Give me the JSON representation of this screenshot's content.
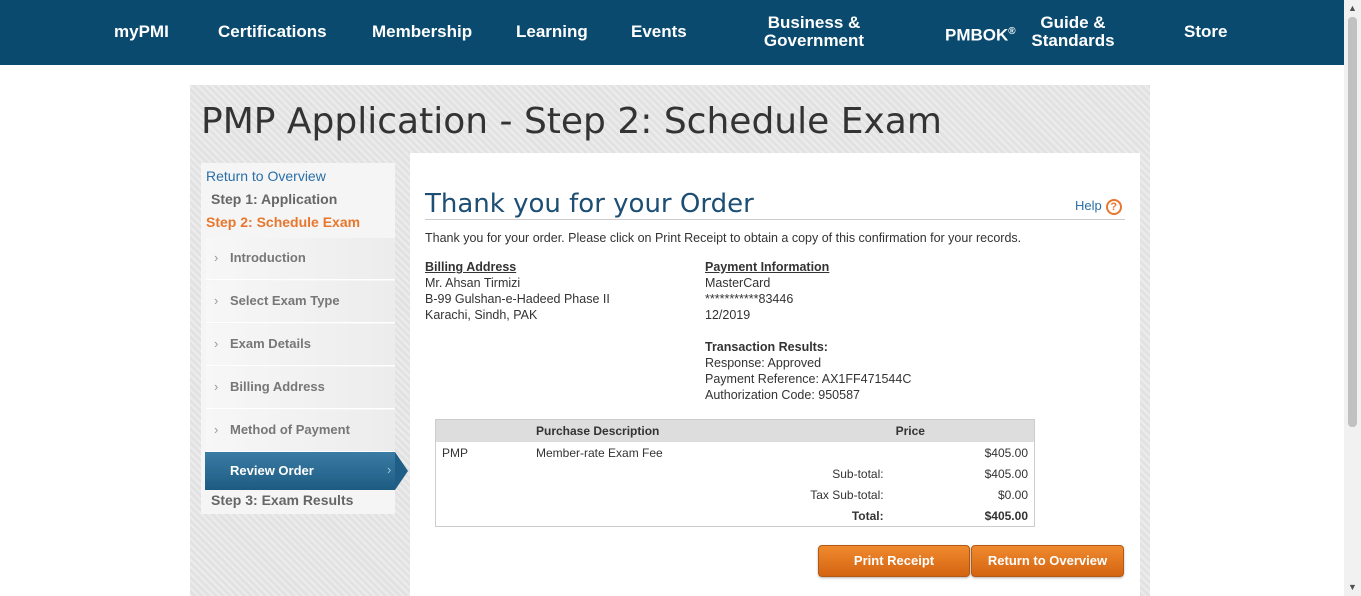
{
  "nav": {
    "mypmi": "myPMI",
    "certifications": "Certifications",
    "membership": "Membership",
    "learning": "Learning",
    "events": "Events",
    "business_line1": "Business &",
    "business_line2": "Government",
    "pmbok": "PMBOK",
    "pmbok_sup": "®",
    "guide_line1": "Guide &",
    "guide_line2": "Standards",
    "store": "Store"
  },
  "page_title": "PMP Application - Step 2: Schedule Exam",
  "sidebar": {
    "return_link": "Return to Overview",
    "step1": "Step 1: Application",
    "step2": "Step 2: Schedule Exam",
    "items": [
      {
        "label": "Introduction"
      },
      {
        "label": "Select Exam Type"
      },
      {
        "label": "Exam Details"
      },
      {
        "label": "Billing Address"
      },
      {
        "label": "Method of Payment"
      }
    ],
    "active_item": "Review Order",
    "step3": "Step 3: Exam Results"
  },
  "main": {
    "heading": "Thank you for your Order",
    "help": "Help",
    "intro": "Thank you for your order. Please click on Print Receipt to obtain a copy of this confirmation for your records.",
    "billing": {
      "heading": "Billing Address",
      "name": "Mr. Ahsan Tirmizi",
      "line1": "B-99 Gulshan-e-Hadeed Phase II",
      "line2": "Karachi, Sindh, PAK"
    },
    "payment": {
      "heading": "Payment Information",
      "card": "MasterCard",
      "number": "***********83446",
      "expiry": "12/2019"
    },
    "transaction": {
      "heading": "Transaction Results:",
      "response": "Response: Approved",
      "reference": "Payment Reference: AX1FF471544C",
      "auth": "Authorization Code: 950587"
    },
    "table": {
      "headers": {
        "code": "",
        "description": "Purchase Description",
        "price": "Price"
      },
      "rows": [
        {
          "code": "PMP",
          "description": "Member-rate Exam Fee",
          "price": "$405.00"
        }
      ],
      "subtotal_label": "Sub-total:",
      "subtotal": "$405.00",
      "tax_label": "Tax Sub-total:",
      "tax": "$0.00",
      "total_label": "Total:",
      "total": "$405.00"
    },
    "buttons": {
      "print": "Print Receipt",
      "return": "Return to Overview"
    }
  },
  "colors": {
    "nav_bg": "#0a4a6e",
    "accent_orange": "#e8772e",
    "link_blue": "#2a6fa8",
    "heading_blue": "#1d4e74"
  }
}
